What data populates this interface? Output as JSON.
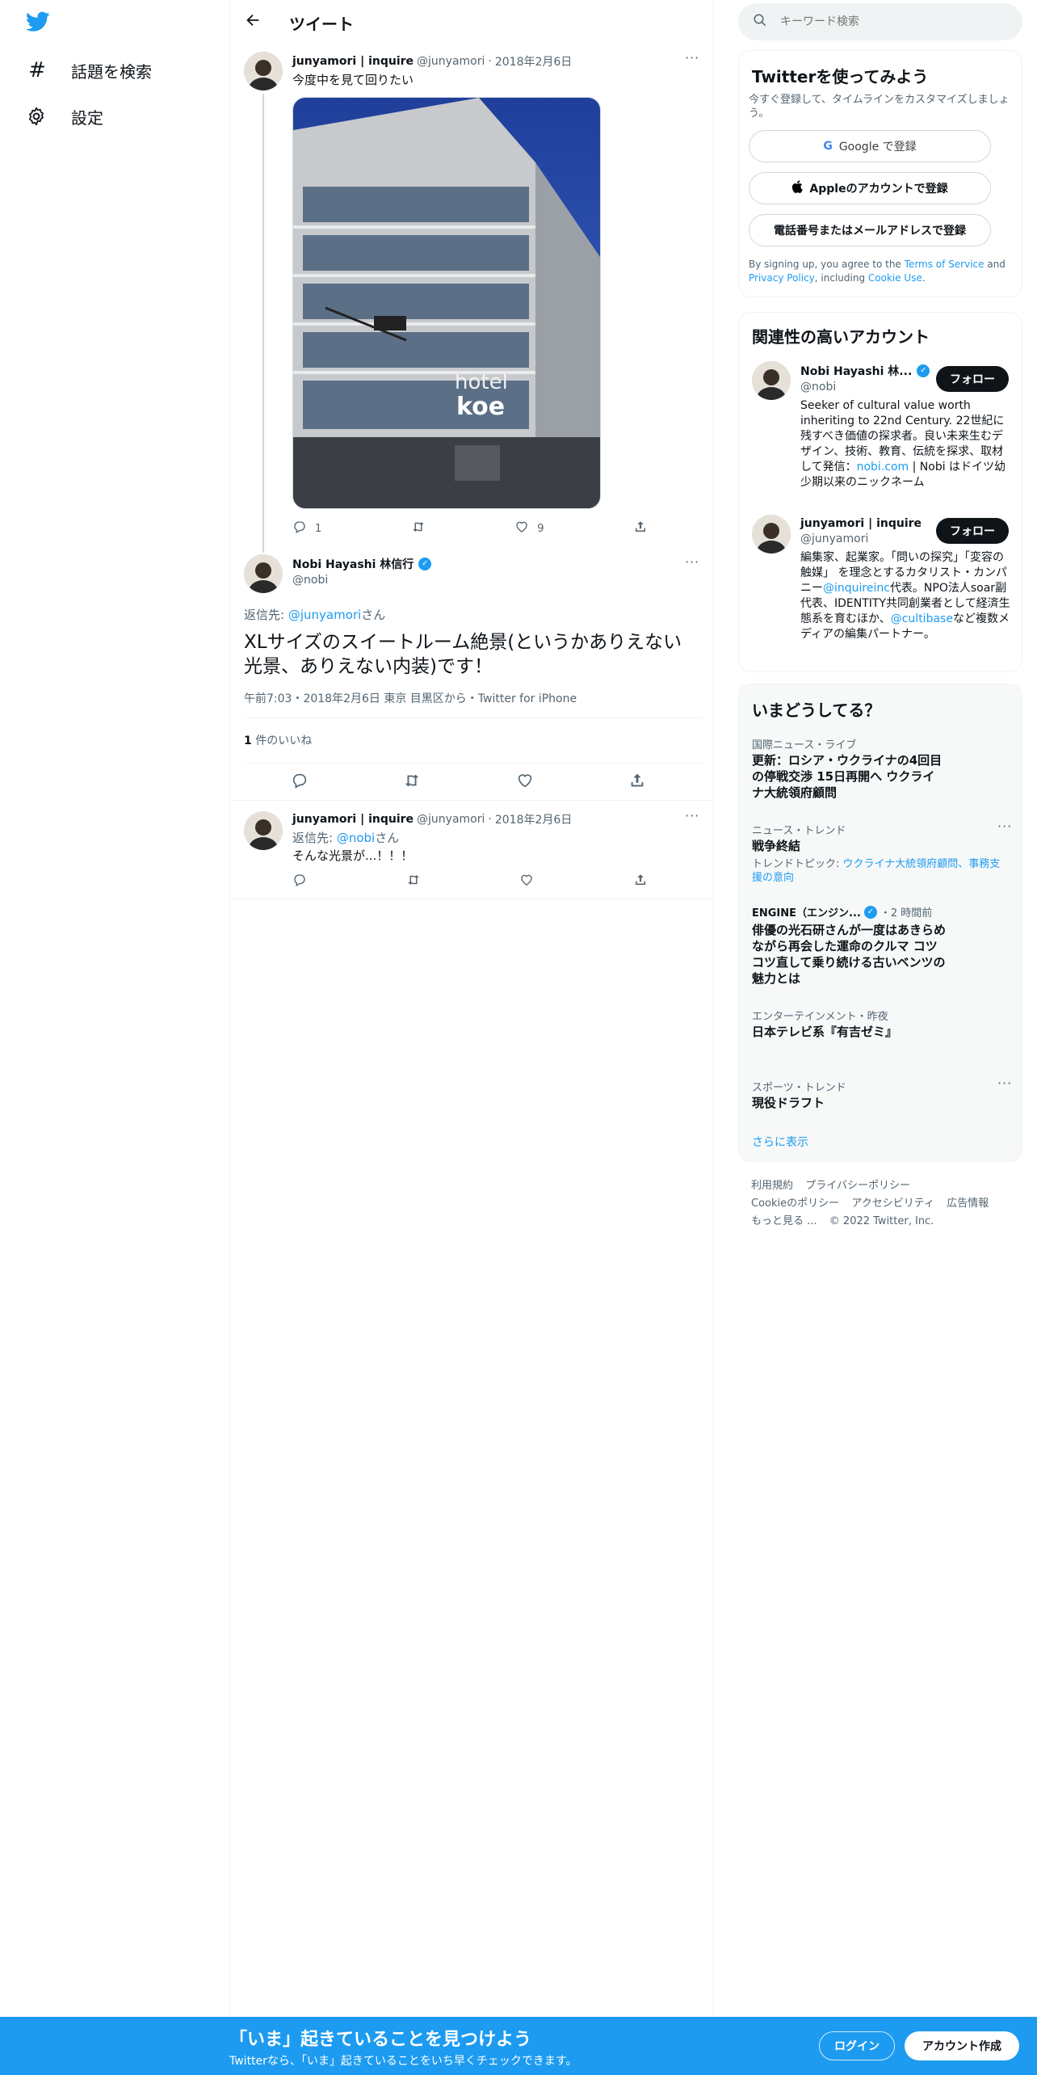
{
  "nav": {
    "explore_label": "話題を検索",
    "settings_label": "設定"
  },
  "header": {
    "title": "ツイート"
  },
  "parent_tweet": {
    "display_name": "junyamori | inquire",
    "handle": "@junyamori",
    "date": "2018年2月6日",
    "text": "今度中を見て回りたい",
    "reply_count": "1",
    "like_count": "9",
    "image_sign_1": "hotel",
    "image_sign_2": "koe"
  },
  "main_tweet": {
    "display_name": "Nobi Hayashi 林信行",
    "handle": "@nobi",
    "reply_to_prefix": "返信先: ",
    "reply_to_handle": "@junyamori",
    "reply_to_suffix": "さん",
    "text": "XLサイズのスイートルーム絶景(というかありえない光景、ありえない内装)です！",
    "meta": "午前7:03・2018年2月6日 東京 目黒区から・Twitter for iPhone",
    "likes_count": "1",
    "likes_label": " 件のいいね"
  },
  "reply_tweet": {
    "display_name": "junyamori | inquire",
    "handle": "@junyamori",
    "date": "2018年2月6日",
    "reply_to_prefix": "返信先: ",
    "reply_to_handle": "@nobi",
    "reply_to_suffix": "さん",
    "text": "そんな光景が...！！！"
  },
  "search": {
    "placeholder": "キーワード検索"
  },
  "signup": {
    "title": "Twitterを使ってみよう",
    "subtitle": "今すぐ登録して、タイムラインをカスタマイズしましょう。",
    "google_button": "Google で登録",
    "apple_button": "Appleのアカウントで登録",
    "phone_button": "電話番号またはメールアドレスで登録",
    "legal_1": "By signing up, you agree to the ",
    "legal_tos": "Terms of Service",
    "legal_2": " and ",
    "legal_privacy": "Privacy Policy",
    "legal_3": ", including ",
    "legal_cookie": "Cookie Use",
    "legal_4": "."
  },
  "related": {
    "title": "関連性の高いアカウント",
    "follow_label": "フォロー",
    "accounts": [
      {
        "display_name": "Nobi Hayashi 林...",
        "handle": "@nobi",
        "bio_1": "Seeker of cultural value worth inheriting to 22nd Century. 22世紀に残すべき価値の探求者。良い未来生むデザイン、技術、教育、伝統を探求、取材して発信：",
        "bio_link": "nobi.com",
        "bio_2": " | Nobi はドイツ幼少期以来のニックネーム"
      },
      {
        "display_name": "junyamori | inquire",
        "handle": "@junyamori",
        "bio_1": "編集家、起業家。「問いの探究」「変容の触媒」 を理念とするカタリスト・カンパニー",
        "bio_link": "@inquireinc",
        "bio_2": "代表。NPO法人soar副代表、IDENTITY共同創業者として経済生態系を育むほか、",
        "bio_link2": "@cultibase",
        "bio_3": "など複数メディアの編集パートナー。"
      }
    ]
  },
  "trends": {
    "title": "いまどうしてる？",
    "items": [
      {
        "category": "国際ニュース・ライブ",
        "title": "更新：ロシア・ウクライナの4回目の停戦交渉 15日再開へ ウクライナ大統領府顧問"
      },
      {
        "category": "ニュース・トレンド",
        "title": "戦争終結",
        "topic_prefix": "トレンドトピック: ",
        "topic_links": "ウクライナ大統領府顧問、事務支援の意向"
      },
      {
        "category": "ENGINE（エンジン...",
        "time": "・2 時間前",
        "title": "俳優の光石研さんが一度はあきらめながら再会した運命のクルマ コツコツ直して乗り続ける古いベンツの魅力とは"
      },
      {
        "category": "エンターテインメント・昨夜",
        "title": "日本テレビ系『有吉ゼミ』"
      },
      {
        "category": "スポーツ・トレンド",
        "title": "現役ドラフト"
      }
    ],
    "show_more": "さらに表示"
  },
  "footer": {
    "terms": "利用規約",
    "privacy": "プライバシーポリシー",
    "cookie": "Cookieのポリシー",
    "accessibility": "アクセシビリティ",
    "ads": "広告情報",
    "more": "もっと見る ...",
    "copyright": "© 2022 Twitter, Inc."
  },
  "bottom_bar": {
    "title": "「いま」起きていることを見つけよう",
    "subtitle": "Twitterなら、「いま」起きていることをいち早くチェックできます。",
    "login": "ログイン",
    "signup": "アカウント作成"
  },
  "colors": {
    "accent": "#1d9bf0",
    "text": "#0f1419",
    "secondary": "#536471"
  }
}
